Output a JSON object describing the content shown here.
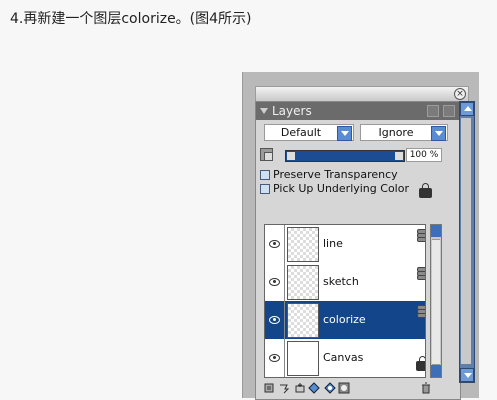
{
  "caption": "4.再新建一个图层colorize。(图4所示)",
  "panel": {
    "title": "Layers",
    "blend_mode": "Default",
    "composite_mode": "Ignore",
    "opacity_pct": "100 %",
    "options": [
      "Preserve Transparency",
      "Pick Up Underlying Color"
    ],
    "layers": [
      {
        "name": "line",
        "selected": false
      },
      {
        "name": "sketch",
        "selected": false
      },
      {
        "name": "colorize",
        "selected": true
      },
      {
        "name": "Canvas",
        "selected": false
      }
    ],
    "accent": "#12458a"
  }
}
